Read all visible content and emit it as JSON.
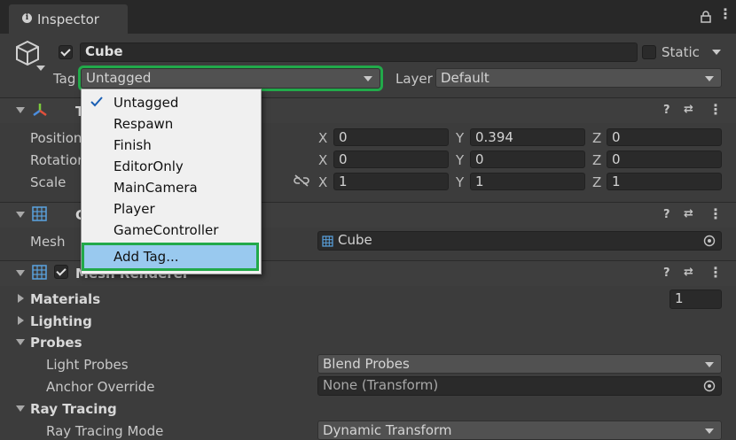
{
  "window": {
    "tab_title": "Inspector"
  },
  "object": {
    "name": "Cube",
    "static_label": "Static",
    "tag_label": "Tag",
    "tag_value": "Untagged",
    "layer_label": "Layer",
    "layer_value": "Default"
  },
  "transform": {
    "title": "T",
    "rows": [
      {
        "label": "Position",
        "x": "0",
        "y": "0.394",
        "z": "0"
      },
      {
        "label": "Rotation",
        "x": "0",
        "y": "0",
        "z": "0"
      },
      {
        "label": "Scale",
        "x": "1",
        "y": "1",
        "z": "1"
      }
    ],
    "axes": {
      "x": "X",
      "y": "Y",
      "z": "Z"
    }
  },
  "mesh_filter": {
    "title": "C",
    "mesh_label": "Mesh",
    "mesh_value": "Cube"
  },
  "mesh_renderer": {
    "title": "Mesh Renderer",
    "materials_label": "Materials",
    "materials_count": "1",
    "lighting_label": "Lighting",
    "probes_label": "Probes",
    "light_probes_label": "Light Probes",
    "light_probes_value": "Blend Probes",
    "anchor_override_label": "Anchor Override",
    "anchor_override_value": "None (Transform)",
    "ray_tracing_label": "Ray Tracing",
    "ray_tracing_mode_label": "Ray Tracing Mode",
    "ray_tracing_mode_value": "Dynamic Transform"
  },
  "tag_menu": {
    "items": [
      "Untagged",
      "Respawn",
      "Finish",
      "EditorOnly",
      "MainCamera",
      "Player",
      "GameController"
    ],
    "selected": "Untagged",
    "add_tag": "Add Tag..."
  },
  "icons": {
    "info": "info-icon",
    "lock": "lock-icon",
    "menu": "kebab-menu-icon",
    "cube": "cube-icon",
    "transform": "transform-icon",
    "grid": "mesh-grid-icon",
    "help": "help-icon",
    "presets": "presets-icon",
    "link": "constrain-proportions-icon",
    "target": "object-picker-icon",
    "check": "checkmark-icon"
  },
  "colors": {
    "highlight_outline": "#22a94a",
    "menu_selected": "#99c9ef",
    "panel_bg": "#3c3c3c",
    "field_bg": "#2a2a2a"
  }
}
